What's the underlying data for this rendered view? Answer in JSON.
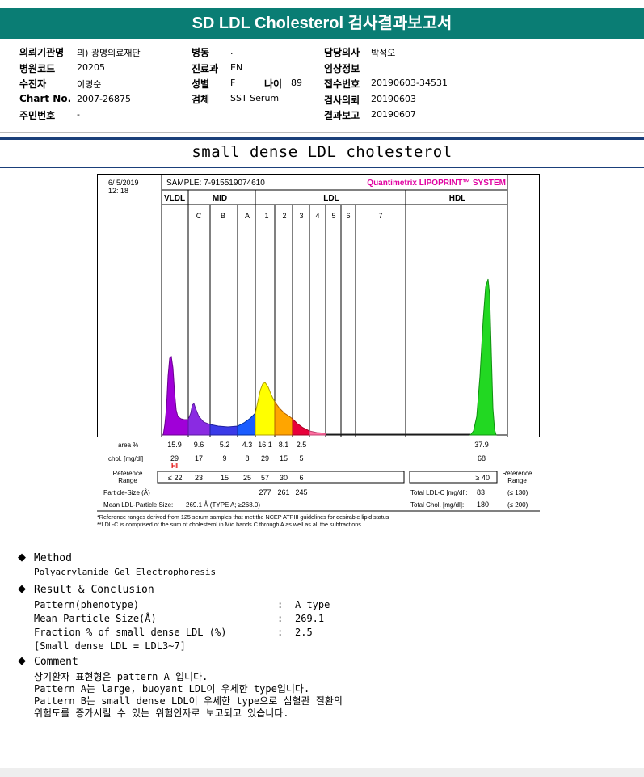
{
  "header": {
    "title": "SD LDL Cholesterol 검사결과보고서"
  },
  "info": {
    "col1": [
      {
        "label": "의뢰기관명",
        "value": "의) 광명의료재단"
      },
      {
        "label": "병원코드",
        "value": "20205"
      },
      {
        "label": "수진자",
        "value": "이명순"
      },
      {
        "label": "Chart No.",
        "value": "2007-26875"
      },
      {
        "label": "주민번호",
        "value": "-"
      }
    ],
    "col2": [
      {
        "label": "병동",
        "value": "."
      },
      {
        "label": "진료과",
        "value": "EN"
      },
      {
        "label": "성별",
        "value": "F"
      },
      {
        "label": "검체",
        "value": "SST Serum"
      }
    ],
    "age": {
      "label": "나이",
      "value": "89"
    },
    "col3": [
      {
        "label": "담당의사",
        "value": "박석오"
      },
      {
        "label": "임상정보",
        "value": ""
      },
      {
        "label": "접수번호",
        "value": "20190603-34531"
      },
      {
        "label": "검사의뢰",
        "value": "20190603"
      },
      {
        "label": "결과보고",
        "value": "20190607"
      }
    ]
  },
  "section_title": "small dense LDL cholesterol",
  "chart_data": {
    "type": "area",
    "title": "Quantimetrix LIPOPRINT™ SYSTEM",
    "date": "6/ 5/2019",
    "time": "12: 18",
    "sample": "SAMPLE:   7-915519074610",
    "band_groups": [
      "VLDL",
      "MID",
      "LDL",
      "HDL"
    ],
    "mid_bands": [
      "C",
      "B",
      "A"
    ],
    "ldl_bands": [
      "1",
      "2",
      "3",
      "4",
      "5",
      "6",
      "7"
    ],
    "curve_colors": {
      "vldl": "#a000d8",
      "mid_c": "#8a2be2",
      "mid_a": "#1a5cff",
      "ldl1": "#ffff00",
      "ldl2": "#ffa500",
      "ldl3": "#e8003a",
      "hdl": "#22d822"
    },
    "row_labels": {
      "area": "area %",
      "chol": "chol. [mg/dl]",
      "ref": "Reference\nRange",
      "ref_right": "Reference\nRange",
      "particle": "Particle-Size (Å)",
      "mean": "Mean LDL-Particle Size:",
      "mean_value": "269.1 Å   (TYPE A; ≥268.0)"
    },
    "area_pct": [
      "15.9",
      "9.6",
      "5.2",
      "4.3",
      "16.1",
      "8.1",
      "2.5",
      "37.9"
    ],
    "chol": [
      "29",
      "17",
      "9",
      "8",
      "29",
      "15",
      "5",
      "68"
    ],
    "hi_flag": "HI",
    "reference": [
      "≤  22",
      "23",
      "15",
      "25",
      "57",
      "30",
      "6",
      "≥ 40"
    ],
    "particle_size": [
      "277",
      "261",
      "245"
    ],
    "total_ldlc": {
      "label": "Total LDL-C [mg/dl]:",
      "value": "83",
      "ref": "(≤ 130)"
    },
    "total_chol": {
      "label": "Total Chol. [mg/dl]:",
      "value": "180",
      "ref": "(≤ 200)"
    },
    "footnotes": [
      "*Reference ranges derived from 125 serum samples that met the NCEP ATPIII guidelines for desirable lipid status",
      "**LDL-C is comprised of the sum of cholesterol in Mid bands C through A as well as all the subfractions"
    ]
  },
  "method": {
    "heading": "Method",
    "text": "Polyacrylamide Gel Electrophoresis"
  },
  "result": {
    "heading": "Result & Conclusion",
    "rows": [
      {
        "label": "Pattern(phenotype)",
        "colon": ":",
        "value": "A type"
      },
      {
        "label": "Mean Particle Size(Å)",
        "colon": ":",
        "value": "269.1"
      },
      {
        "label": "Fraction % of small dense LDL (%)",
        "colon": ":",
        "value": "2.5"
      }
    ],
    "note": "[Small dense LDL = LDL3~7]"
  },
  "comment": {
    "heading": "Comment",
    "lines": [
      "상기환자 표현형은 pattern A 입니다.",
      "Pattern A는 large, buoyant LDL이 우세한 type입니다.",
      "Pattern B는 small dense LDL이 우세한 type으로 심혈관 질환의",
      "위험도를 증가시킬 수 있는 위험인자로 보고되고 있습니다."
    ]
  }
}
